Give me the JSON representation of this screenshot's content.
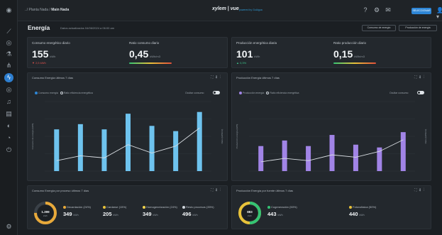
{
  "app": {
    "breadcrumb_prefix": "../ Planta Nada /",
    "breadcrumb_current": "Main Nada",
    "brand": "xylem | vue",
    "brand_sub": "powered by GoAigua",
    "site_button": "SELECCIONAR",
    "accent": "#2e86d6"
  },
  "sidebar": {
    "items": [
      {
        "icon": "location-pin-icon"
      },
      {
        "icon": "chart-line-icon"
      },
      {
        "icon": "target-icon"
      },
      {
        "icon": "flask-icon"
      },
      {
        "icon": "network-icon"
      },
      {
        "icon": "energy-bolt-icon",
        "active": true
      },
      {
        "icon": "coin-icon"
      },
      {
        "icon": "bell-icon"
      },
      {
        "icon": "document-icon"
      },
      {
        "icon": "layers-icon"
      },
      {
        "icon": "gauge-icon"
      },
      {
        "icon": "power-icon"
      },
      {
        "icon": "settings-icon"
      }
    ]
  },
  "page": {
    "title": "Energía",
    "updated": "Datos actualizados 04/06/2024 a 06:00 am",
    "btn_consumo": "Consumo de energía",
    "btn_produccion": "Producción de energía"
  },
  "kpis": {
    "consumo_label": "Consumo energético diario",
    "consumo_value": "155",
    "consumo_unit": "kWh",
    "consumo_delta": "▼ 2,5 kWh",
    "ratio_consumo_label": "Ratio consumo diario",
    "ratio_consumo_value": "0,45",
    "ratio_consumo_unit": "kWh/m3",
    "prod_label": "Producción energética diaria",
    "prod_value": "101",
    "prod_unit": "kWh",
    "prod_delta": "▲ 0,3%",
    "ratio_prod_label": "Ratio producción diario",
    "ratio_prod_value": "0,15",
    "ratio_prod_unit": "kWh/m3"
  },
  "charts": {
    "consumo_title": "Consumo Energía últimos 7 días",
    "consumo_legend_a": "Consumo energía",
    "consumo_legend_b": "Ratio eficiencia energética",
    "consumo_toggle": "Ocultar consumo",
    "consumo_ylabel_left": "Consumo de energía (kWh)",
    "consumo_ylabel_right": "Ratio (kWh/m3)",
    "prod_title": "Producción Energía últimos 7 días",
    "prod_legend_a": "Producción energía",
    "prod_legend_b": "Ratio eficiencia energética",
    "prod_toggle": "Ocultar consumo",
    "prod_ylabel_left": "Producción energía (kWh)",
    "prod_ylabel_right": "Ratio (kWh/m3)"
  },
  "breakdown": {
    "consumo_title": "Consumo Energía por proceso últimos 7 días",
    "consumo_total": "1.399",
    "consumo_total_unit": "kWh",
    "consumo_items": [
      {
        "label": "Decantación (24%)",
        "value": "349",
        "unit": "kWh",
        "color": "#e8a93a"
      },
      {
        "label": "Cardarse (15%)",
        "value": "205",
        "unit": "kWh",
        "color": "#e8c23a"
      },
      {
        "label": "Homogeneización (24%)",
        "value": "349",
        "unit": "kWh",
        "color": "#f0d34c"
      },
      {
        "label": "Resto procesos (35%)",
        "value": "496",
        "unit": "kWh",
        "color": "#cfd5db"
      }
    ],
    "prod_title": "Producción Energía por fuente últimos 7 días",
    "prod_total": "883",
    "prod_total_unit": "kWh",
    "prod_items": [
      {
        "label": "Cogeneración (50%)",
        "value": "443",
        "unit": "kWh",
        "color": "#34c474"
      },
      {
        "label": "Fotovoltaica (50%)",
        "value": "440",
        "unit": "kWh",
        "color": "#e8c23a"
      }
    ]
  },
  "chart_data": [
    {
      "type": "bar",
      "title": "Consumo Energía últimos 7 días",
      "categories": [
        "",
        "",
        "",
        "",
        "",
        "",
        ""
      ],
      "series": [
        {
          "name": "Consumo energía",
          "values": [
            120,
            135,
            120,
            165,
            130,
            115,
            170
          ],
          "color": "#6ec3ee"
        },
        {
          "name": "Ratio eficiencia energética",
          "values": [
            0.15,
            0.22,
            0.19,
            0.38,
            0.26,
            0.36,
            0.62
          ],
          "color": "#d9dee3"
        }
      ],
      "ylim": [
        0,
        200
      ],
      "y2lim": [
        0,
        1
      ]
    },
    {
      "type": "bar",
      "title": "Producción Energía últimos 7 días",
      "categories": [
        "",
        "",
        "",
        "",
        "",
        "",
        ""
      ],
      "series": [
        {
          "name": "Producción energía",
          "values": [
            90,
            110,
            90,
            130,
            95,
            85,
            140
          ],
          "color": "#a184e6"
        },
        {
          "name": "Ratio eficiencia energética",
          "values": [
            0.08,
            0.11,
            0.09,
            0.14,
            0.12,
            0.17,
            0.27
          ],
          "color": "#d9dee3"
        }
      ],
      "ylim": [
        0,
        250
      ],
      "y2lim": [
        0,
        0.6
      ]
    }
  ]
}
